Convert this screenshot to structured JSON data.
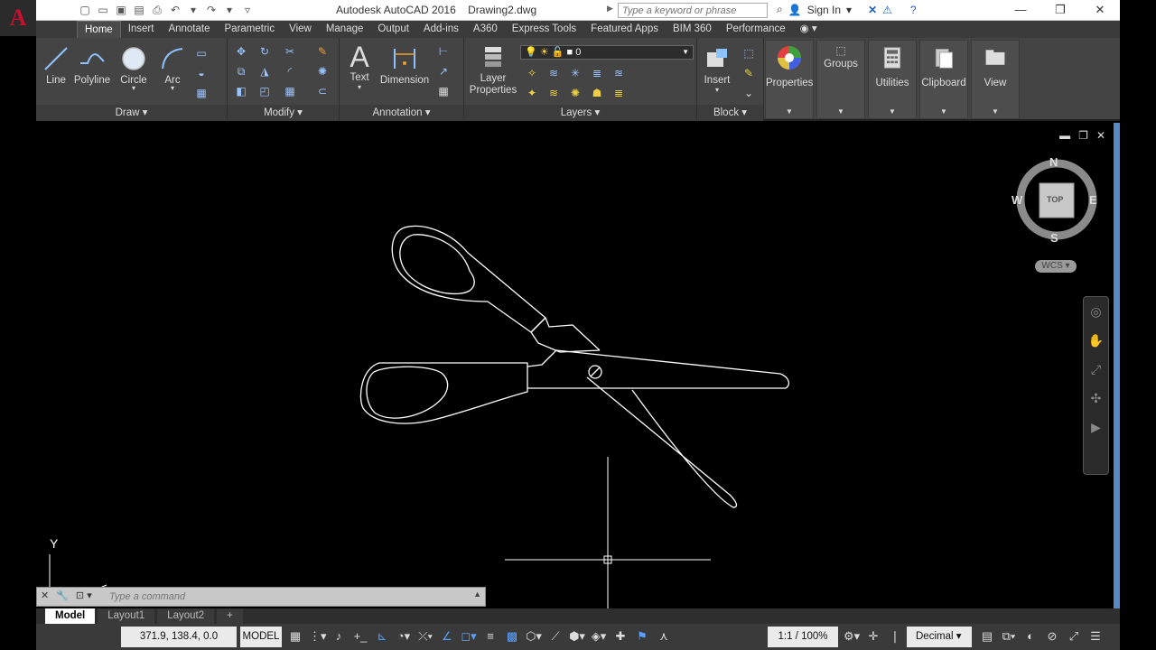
{
  "titlebar": {
    "app_name": "Autodesk AutoCAD 2016",
    "doc_name": "Drawing2.dwg",
    "search_placeholder": "Type a keyword or phrase",
    "sign_in": "Sign In"
  },
  "ribbon_tabs": [
    "Home",
    "Insert",
    "Annotate",
    "Parametric",
    "View",
    "Manage",
    "Output",
    "Add-ins",
    "A360",
    "Express Tools",
    "Featured Apps",
    "BIM 360",
    "Performance"
  ],
  "draw_panel": {
    "title": "Draw",
    "tools": [
      "Line",
      "Polyline",
      "Circle",
      "Arc"
    ]
  },
  "modify_panel": {
    "title": "Modify"
  },
  "annotation_panel": {
    "title": "Annotation",
    "tools": [
      "Text",
      "Dimension"
    ]
  },
  "layers_panel": {
    "title": "Layers",
    "layer_properties": "Layer Properties",
    "current_layer": "0"
  },
  "block_panel": {
    "title": "Block",
    "insert": "Insert"
  },
  "big_buttons": [
    "Properties",
    "Groups",
    "Utilities",
    "Clipboard",
    "View"
  ],
  "viewcube": {
    "north": "N",
    "south": "S",
    "east": "E",
    "west": "W",
    "face": "TOP",
    "wcs": "WCS"
  },
  "ucs": {
    "y_label": "Y"
  },
  "command": {
    "placeholder": "Type a command"
  },
  "layout_tabs": [
    "Model",
    "Layout1",
    "Layout2"
  ],
  "status": {
    "coords": "371.9, 138.4, 0.0",
    "model": "MODEL",
    "scale": "1:1 / 100%",
    "units": "Decimal"
  }
}
